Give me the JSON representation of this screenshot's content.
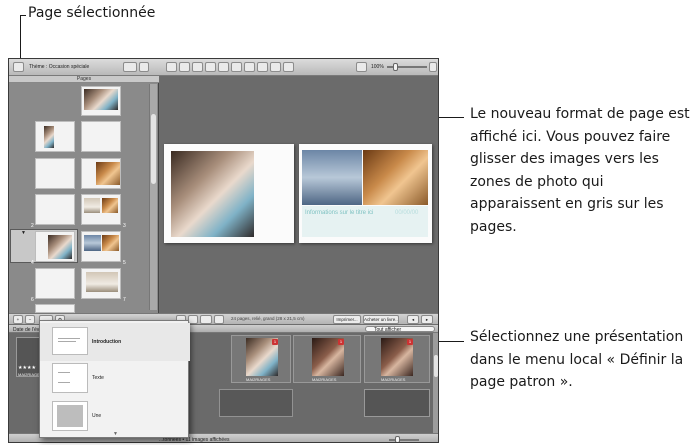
{
  "callouts": {
    "top": "Page sélectionnée",
    "right1": "Le nouveau format de page est affiché ici. Vous pouvez faire glisser des images vers les zones de photo qui apparaissent en gris sur les pages.",
    "right2": "Sélectionnez une présentation dans le menu local « Définir la page patron »."
  },
  "toolbar": {
    "theme_label": "Thème : Occasion spéciale",
    "zoom": "100%"
  },
  "pages_panel": {
    "header": "Pages",
    "page_numbers": [
      "2",
      "3",
      "4",
      "5",
      "6",
      "7"
    ]
  },
  "spread": {
    "left_caption": "Informations sur le titre ici",
    "right_caption": "00/00/00"
  },
  "bottom_bar": {
    "info": "24 pages, relié, grand (28 x 21,5 cm)",
    "print_label": "Imprimer...",
    "buy_label": "Acheter un livre..."
  },
  "browser": {
    "sort_label": "Date de l'év",
    "filter_label": "Tout afficher",
    "footer_info": "...tonnées • 11 images affichées",
    "thumbs": [
      {
        "label": "MAI2RIAGES",
        "stars": "★★★★"
      },
      {
        "label": "MAI2RIAGES",
        "stars": "1★"
      },
      {
        "label": "MAI2RIAGES",
        "stars": "1★"
      },
      {
        "label": "MAI2RIAGES",
        "stars": "1★"
      }
    ]
  },
  "popup": {
    "items": [
      "Introduction",
      "Texte",
      "Une"
    ]
  }
}
